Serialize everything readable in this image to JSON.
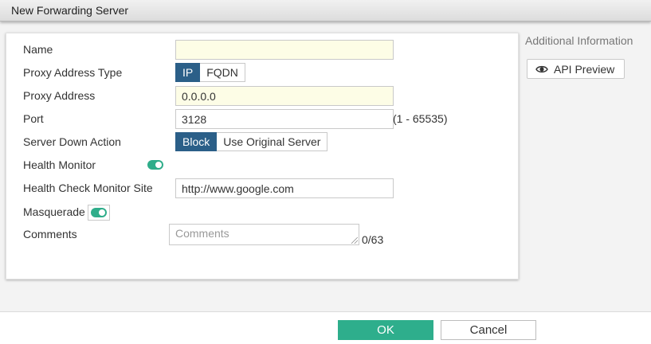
{
  "dialog": {
    "title": "New Forwarding Server"
  },
  "form": {
    "name": {
      "label": "Name",
      "value": ""
    },
    "proxy_address_type": {
      "label": "Proxy Address Type",
      "options": [
        "IP",
        "FQDN"
      ],
      "selected": "IP"
    },
    "proxy_address": {
      "label": "Proxy Address",
      "value": "0.0.0.0"
    },
    "port": {
      "label": "Port",
      "value": "3128",
      "range_hint": "(1 - 65535)"
    },
    "server_down_action": {
      "label": "Server Down Action",
      "options": [
        "Block",
        "Use Original Server"
      ],
      "selected": "Block"
    },
    "health_monitor": {
      "label": "Health Monitor",
      "enabled": true
    },
    "health_check_monitor_site": {
      "label": "Health Check Monitor Site",
      "value": "http://www.google.com"
    },
    "masquerade": {
      "label": "Masquerade",
      "enabled": true
    },
    "comments": {
      "label": "Comments",
      "placeholder": "Comments",
      "value": "",
      "char_count": "0/63"
    }
  },
  "sidebar": {
    "title": "Additional Information",
    "api_preview_label": "API Preview",
    "api_preview_icon": "eye-icon"
  },
  "footer": {
    "ok_label": "OK",
    "cancel_label": "Cancel"
  },
  "colors": {
    "active_segment": "#2b5f88",
    "toggle_on": "#2fad8a",
    "ok_button": "#2eae8c",
    "highlighted_input": "#fdfde6"
  }
}
